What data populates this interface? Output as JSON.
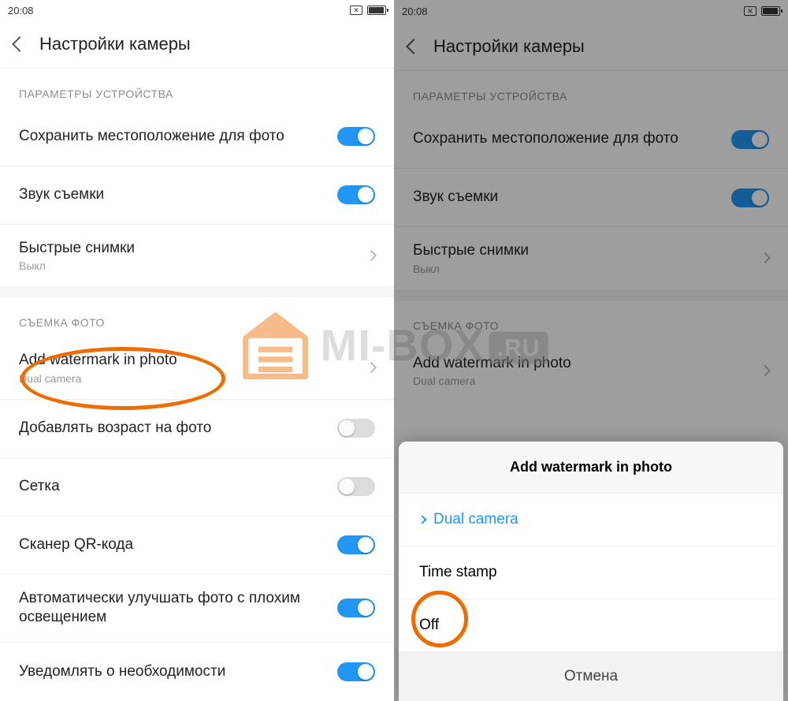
{
  "status": {
    "time": "20:08"
  },
  "header": {
    "title": "Настройки камеры"
  },
  "sections": {
    "device_params": "ПАРАМЕТРЫ УСТРОЙСТВА",
    "shoot_photo": "СЪЕМКА ФОТО"
  },
  "rows": {
    "save_location": {
      "label": "Сохранить местоположение для фото"
    },
    "shutter_sound": {
      "label": "Звук съемки"
    },
    "quick_shots": {
      "label": "Быстрые снимки",
      "sub": "Выкл"
    },
    "watermark": {
      "label": "Add watermark in photo",
      "sub": "Dual camera"
    },
    "age_on_photo": {
      "label": "Добавлять возраст на фото"
    },
    "grid": {
      "label": "Сетка"
    },
    "qr_scanner": {
      "label": "Сканер QR-кода"
    },
    "auto_enhance": {
      "label": "Автоматически улучшать фото с плохим освещением"
    },
    "notify_need": {
      "label": "Уведомлять о необходимости"
    }
  },
  "sheet": {
    "title": "Add watermark in photo",
    "opt_dual": "Dual camera",
    "opt_time": "Time stamp",
    "opt_off": "Off",
    "cancel": "Отмена"
  },
  "watermark_text": {
    "main": "MI-BOX",
    "suffix": ".RU"
  }
}
